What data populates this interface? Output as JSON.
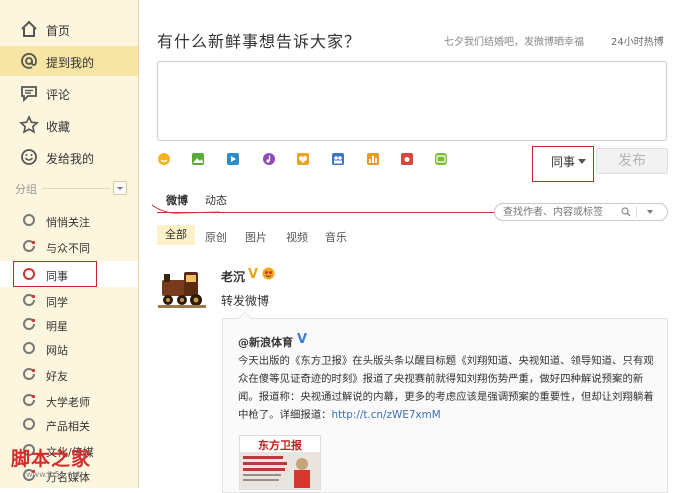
{
  "sidebar": {
    "nav": [
      {
        "label": "首页",
        "icon": "home-icon"
      },
      {
        "label": "提到我的",
        "icon": "at-icon"
      },
      {
        "label": "评论",
        "icon": "comment-icon"
      },
      {
        "label": "收藏",
        "icon": "star-icon"
      },
      {
        "label": "发给我的",
        "icon": "smile-icon"
      }
    ],
    "group_header": "分组",
    "groups": [
      {
        "label": "悄悄关注"
      },
      {
        "label": "与众不同"
      },
      {
        "label": "同事"
      },
      {
        "label": "同学"
      },
      {
        "label": "明星"
      },
      {
        "label": "网站"
      },
      {
        "label": "好友"
      },
      {
        "label": "大学老师"
      },
      {
        "label": "产品相关"
      },
      {
        "label": "文化/传媒"
      },
      {
        "label": "万名媒体"
      }
    ]
  },
  "watermark": {
    "text": "脚本之家",
    "url": "www.jb51.net"
  },
  "composer": {
    "title": "有什么新鲜事想告诉大家？",
    "slogan": "七夕我们结婚吧，发微博晒幸福",
    "slogan_link": "24小时热博",
    "toolbar_icons": [
      "emoji-icon",
      "image-icon",
      "video-icon",
      "music-icon",
      "heart-icon",
      "group-icon",
      "chart-icon",
      "camera-icon",
      "more-icon"
    ],
    "visibility": "同事",
    "publish_label": "发布"
  },
  "tabs": [
    {
      "label": "微博"
    },
    {
      "label": "动态"
    }
  ],
  "search": {
    "placeholder": "查找作者、内容或标签"
  },
  "filters": [
    {
      "label": "全部"
    },
    {
      "label": "原创"
    },
    {
      "label": "图片"
    },
    {
      "label": "视频"
    },
    {
      "label": "音乐"
    }
  ],
  "feed": {
    "author": "老沉",
    "badge": "V",
    "text": "转发微博",
    "original": {
      "author": "@新浪体育",
      "badge": "V",
      "text": "今天出版的《东方卫报》在头版头条以醒目标题《刘翔知道、央视知道、领导知道、只有观众在傻等见证奇迹的时刻》报道了央视赛前就得知刘翔伤势严重，做好四种解说预案的新闻。报道称：央视通过解说的内幕，更多的考虑应该是强调预案的重要性，但却让刘翔躺着中枪了。详细报道：",
      "link": "http://t.cn/zWE7xmM",
      "thumb_title": "东方卫报"
    }
  },
  "colors": {
    "accent": "#c8292c",
    "sidebar_bg": "#fdf6de",
    "active_bg": "#f7e5a3"
  }
}
